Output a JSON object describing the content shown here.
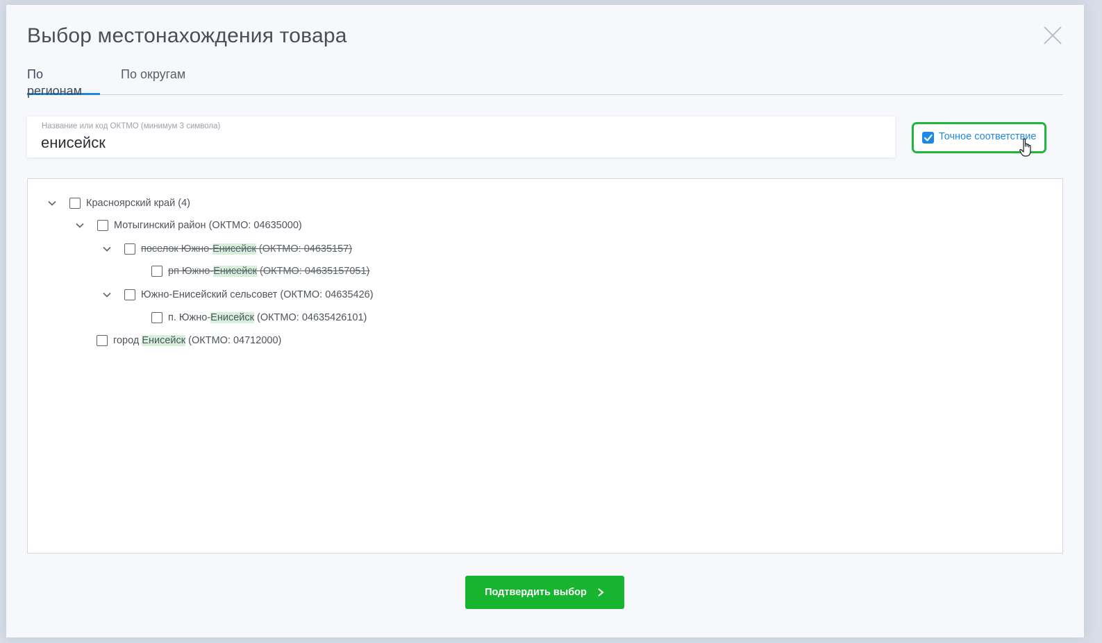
{
  "modal": {
    "title": "Выбор местонахождения товара"
  },
  "tabs": [
    {
      "label": "По регионам",
      "active": true
    },
    {
      "label": "По округам",
      "active": false
    }
  ],
  "search": {
    "label": "Название или код ОКТМО (минимум 3 символа)",
    "value": "енисейск"
  },
  "exact_match": {
    "label": "Точное соответствие",
    "checked": true
  },
  "tree": {
    "rows": [
      {
        "before": "Красноярский край (4)",
        "highlight": "",
        "after": "",
        "strike": false,
        "expanded": true,
        "checked": false
      },
      {
        "before": "Мотыгинский район (ОКТМО: 04635000)",
        "highlight": "",
        "after": "",
        "strike": false,
        "expanded": true,
        "checked": false
      },
      {
        "before": "поселок Южно-",
        "highlight": "Енисейск",
        "after": " (ОКТМО: 04635157)",
        "strike": true,
        "expanded": true,
        "checked": false
      },
      {
        "before": "рп Южно-",
        "highlight": "Енисейск",
        "after": " (ОКТМО: 04635157051)",
        "strike": true,
        "expanded": null,
        "checked": false
      },
      {
        "before": "Южно-Енисейский сельсовет (ОКТМО: 04635426)",
        "highlight": "",
        "after": "",
        "strike": false,
        "expanded": true,
        "checked": false
      },
      {
        "before": "п. Южно-",
        "highlight": "Енисейск",
        "after": " (ОКТМО: 04635426101)",
        "strike": false,
        "expanded": null,
        "checked": false
      },
      {
        "before": "город ",
        "highlight": "Енисейск",
        "after": " (ОКТМО: 04712000)",
        "strike": false,
        "expanded": null,
        "checked": false
      }
    ]
  },
  "confirm": {
    "label": "Подтвердить выбор"
  },
  "colors": {
    "accent": "#1e88e5",
    "confirm": "#17b52f",
    "exact_border": "#1fb83a",
    "highlight": "#d7f0dc"
  }
}
